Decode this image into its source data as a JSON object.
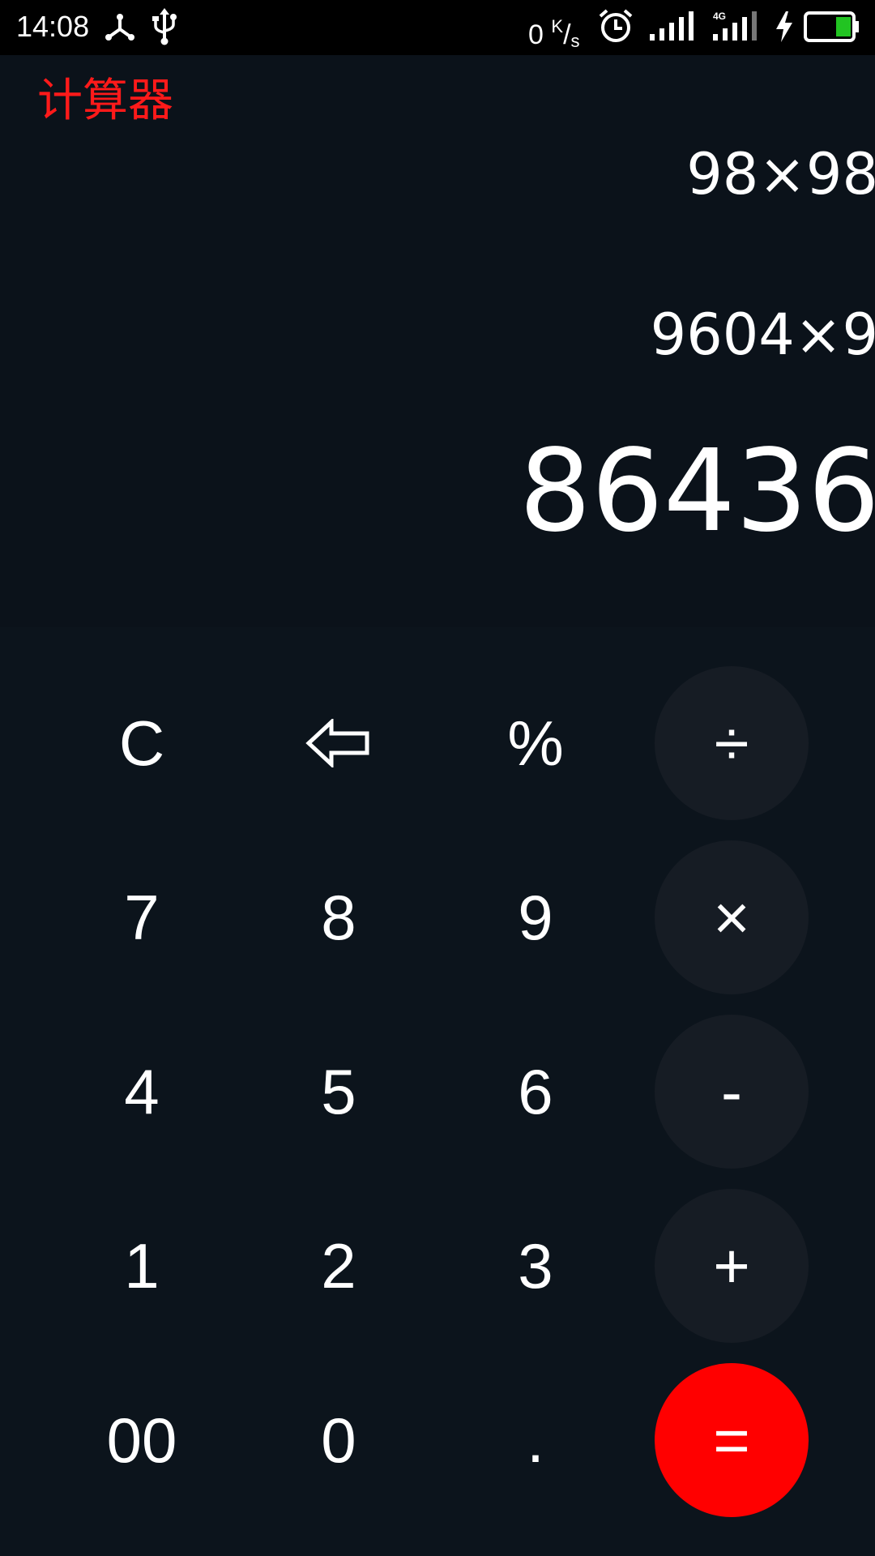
{
  "status_bar": {
    "time": "14:08",
    "speed_value": "0",
    "speed_unit_top": "K",
    "speed_unit_bottom": "s",
    "icons": [
      "network-share-icon",
      "usb-icon",
      "alarm-icon",
      "signal-icon",
      "signal-4g-icon",
      "charging-icon",
      "battery-icon"
    ]
  },
  "app": {
    "title": "计算器",
    "title_color": "#ff1a1a"
  },
  "display": {
    "history_1": "98×98",
    "history_2": "9604×9",
    "result": "86436"
  },
  "keypad": {
    "row1": [
      "C",
      "backspace",
      "%",
      "÷"
    ],
    "row2": [
      "7",
      "8",
      "9",
      "×"
    ],
    "row3": [
      "4",
      "5",
      "6",
      "-"
    ],
    "row4": [
      "1",
      "2",
      "3",
      "+"
    ],
    "row5": [
      "00",
      "0",
      ".",
      "="
    ],
    "labels": {
      "clear": "C",
      "percent": "%",
      "divide": "÷",
      "seven": "7",
      "eight": "8",
      "nine": "9",
      "multiply": "×",
      "four": "4",
      "five": "5",
      "six": "6",
      "minus": "-",
      "one": "1",
      "two": "2",
      "three": "3",
      "plus": "+",
      "double_zero": "00",
      "zero": "0",
      "dot": ".",
      "equals": "="
    },
    "equals_color": "#ff0000",
    "operator_bg": "#161c24"
  }
}
